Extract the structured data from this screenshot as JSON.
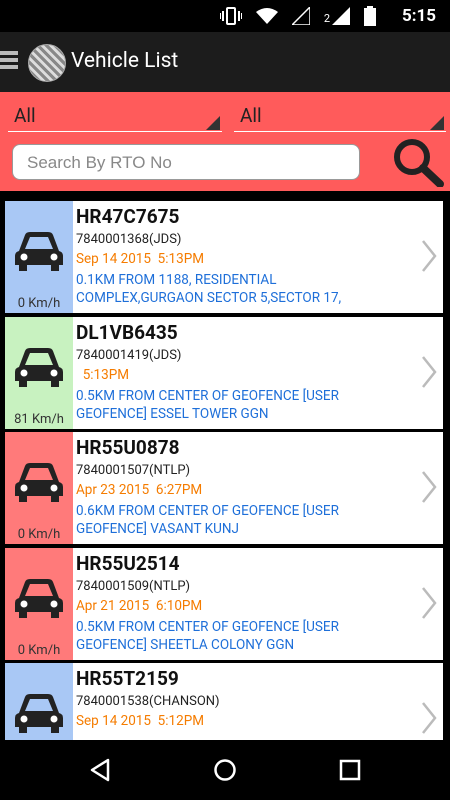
{
  "status": {
    "time": "5:15",
    "sim": "2"
  },
  "appbar": {
    "title": "Vehicle List"
  },
  "filters": {
    "left": "All",
    "right": "All"
  },
  "search": {
    "placeholder": "Search By RTO No"
  },
  "colors": {
    "moving": "#c8f2c0",
    "idle": "#a9c8f5",
    "stopped": "#ff7a7a",
    "filter_bg": "#ff5b5b",
    "time_text": "#f57c00",
    "location_text": "#1e6fd9"
  },
  "vehicles": [
    {
      "reg": "HR47C7675",
      "phone": "7840001368(JDS)",
      "time": "Sep 14 2015  5:13PM",
      "location": "0.1KM FROM 1188, RESIDENTIAL COMPLEX,GURGAON SECTOR 5,SECTOR 17,",
      "speed": "0 Km/h",
      "status": "idle"
    },
    {
      "reg": "DL1VB6435",
      "phone": "7840001419(JDS)",
      "time": "  5:13PM",
      "location": "0.5KM  FROM CENTER OF GEOFENCE [USER GEOFENCE] ESSEL TOWER GGN",
      "speed": "81 Km/h",
      "status": "moving"
    },
    {
      "reg": "HR55U0878",
      "phone": "7840001507(NTLP)",
      "time": "Apr 23 2015  6:27PM",
      "location": "0.6KM  FROM CENTER OF GEOFENCE [USER GEOFENCE] VASANT KUNJ",
      "speed": "0 Km/h",
      "status": "stopped"
    },
    {
      "reg": "HR55U2514",
      "phone": "7840001509(NTLP)",
      "time": "Apr 21 2015  6:10PM",
      "location": "0.5KM  FROM CENTER OF GEOFENCE [USER GEOFENCE] SHEETLA COLONY GGN",
      "speed": "0 Km/h",
      "status": "stopped"
    },
    {
      "reg": "HR55T2159",
      "phone": "7840001538(CHANSON)",
      "time": "Sep 14 2015  5:12PM",
      "location": "",
      "speed": "",
      "status": "idle"
    }
  ]
}
